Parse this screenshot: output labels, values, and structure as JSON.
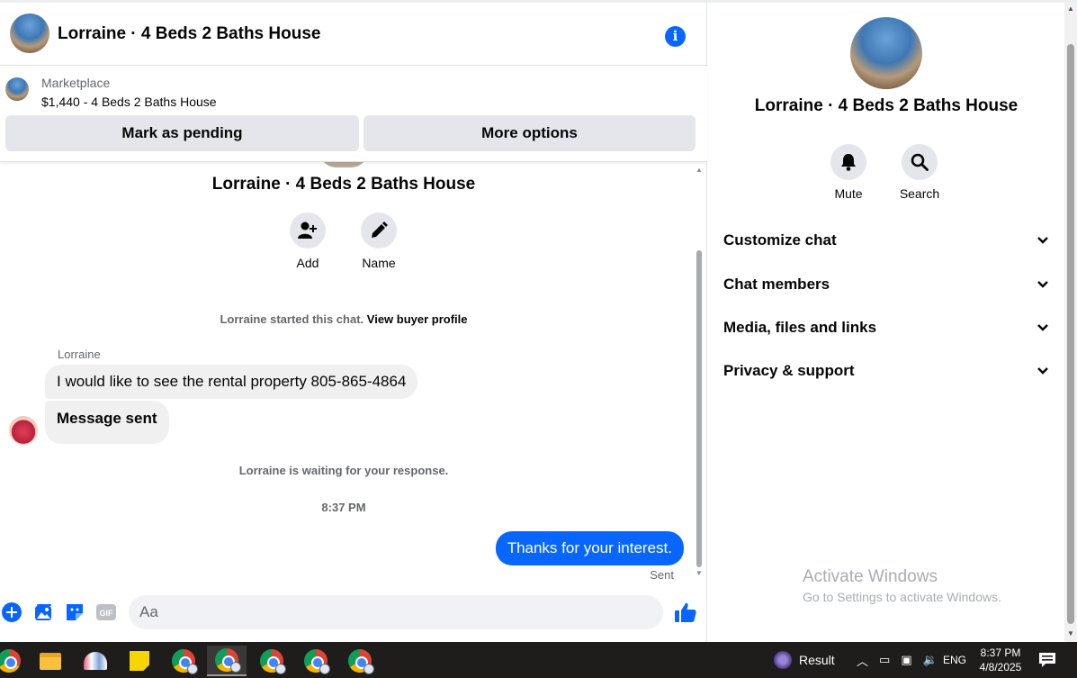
{
  "header": {
    "title": "Lorraine · 4 Beds 2 Baths House"
  },
  "marketplace": {
    "label": "Marketplace",
    "item": "$1,440 - 4 Beds 2 Baths House",
    "mark_pending": "Mark as pending",
    "more_options": "More options"
  },
  "thread": {
    "title": "Lorraine · 4 Beds 2 Baths House",
    "add_label": "Add",
    "name_label": "Name",
    "started_text": "Lorraine started this chat.",
    "view_profile": "View buyer profile",
    "sender": "Lorraine",
    "messages_in": [
      "I would like to see the rental property 805-865-4864",
      "Message sent"
    ],
    "waiting_text": "Lorraine is waiting for your response.",
    "timestamp": "8:37 PM",
    "message_out": "Thanks for your interest.",
    "sent_status": "Sent"
  },
  "composer": {
    "placeholder": "Aa",
    "gif_label": "GIF"
  },
  "panel": {
    "title": "Lorraine · 4 Beds 2 Baths House",
    "mute_label": "Mute",
    "search_label": "Search",
    "sections": [
      "Customize chat",
      "Chat members",
      "Media, files and links",
      "Privacy & support"
    ],
    "watermark_title": "Activate Windows",
    "watermark_sub": "Go to Settings to activate Windows."
  },
  "taskbar": {
    "result_label": "Result",
    "lang": "ENG",
    "time": "8:37 PM",
    "date": "4/8/2025"
  },
  "colors": {
    "accent": "#0866ff",
    "bubble_in": "#f0f0f0",
    "button_bg": "#e4e6eb",
    "taskbar": "#1f1c1c"
  }
}
